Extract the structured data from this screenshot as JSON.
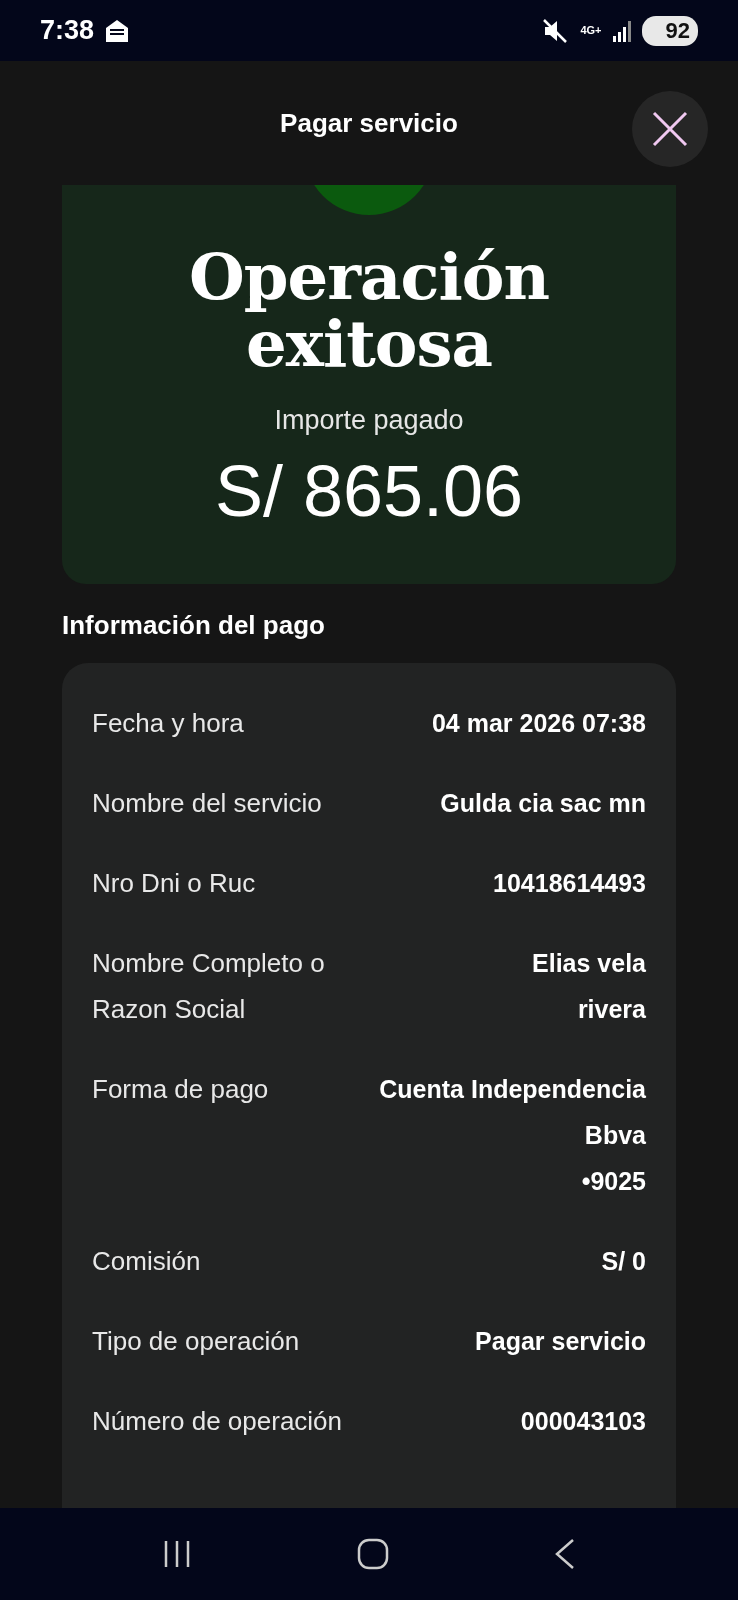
{
  "status_bar": {
    "time": "7:38",
    "network": "4G+",
    "battery": "92"
  },
  "header": {
    "title": "Pagar servicio"
  },
  "result": {
    "title": "Operación exitosa",
    "amount_label": "Importe pagado",
    "amount": "S/ 865.06"
  },
  "section_title": "Información del pago",
  "details": [
    {
      "label": [
        "Fecha y hora"
      ],
      "value": [
        "04 mar 2026 07:38"
      ]
    },
    {
      "label": [
        "Nombre del servicio"
      ],
      "value": [
        "Gulda cia sac mn"
      ]
    },
    {
      "label": [
        "Nro Dni o Ruc"
      ],
      "value": [
        "10418614493"
      ]
    },
    {
      "label": [
        "Nombre Completo o",
        "Razon Social"
      ],
      "value": [
        "Elias vela",
        "rivera"
      ]
    },
    {
      "label": [
        "Forma de pago"
      ],
      "value": [
        "Cuenta Independencia",
        "Bbva",
        "•9025"
      ]
    },
    {
      "label": [
        "Comisión"
      ],
      "value": [
        "S/ 0"
      ]
    },
    {
      "label": [
        "Tipo de operación"
      ],
      "value": [
        "Pagar servicio"
      ]
    },
    {
      "label": [
        "Número de operación"
      ],
      "value": [
        "000043103"
      ]
    }
  ]
}
